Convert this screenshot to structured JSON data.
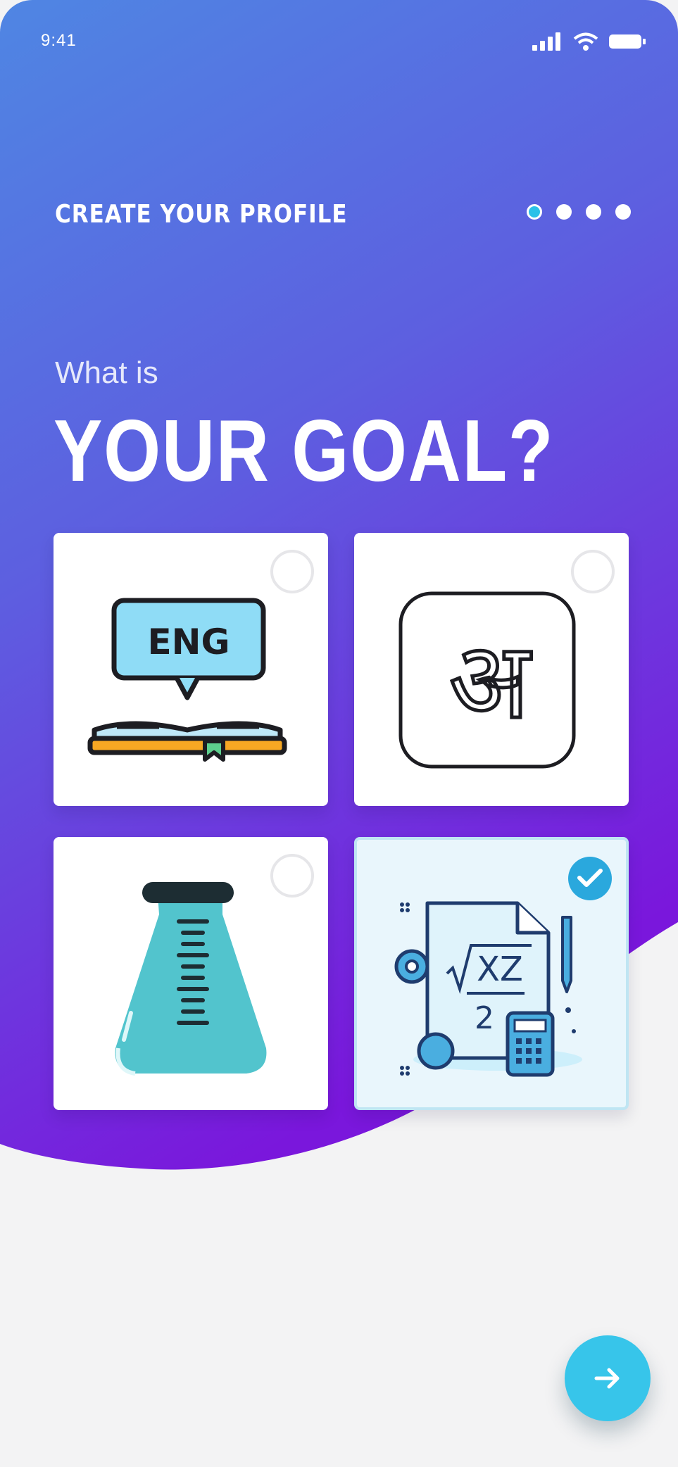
{
  "status_bar": {
    "time": "9:41"
  },
  "header": {
    "kicker": "CREATE YOUR PROFILE",
    "steps": 4,
    "current_step": 1
  },
  "question": {
    "lead": "What is",
    "title": "YOUR GOAL?"
  },
  "goals": [
    {
      "id": "english",
      "icon": "eng-book-icon",
      "badge_text": "ENG",
      "selected": false
    },
    {
      "id": "hindi",
      "icon": "hindi-letter-icon",
      "badge_text": "अ",
      "selected": false
    },
    {
      "id": "science",
      "icon": "flask-icon",
      "selected": false
    },
    {
      "id": "maths",
      "icon": "math-worksheet-icon",
      "badge_text": "√XZ/2",
      "selected": true
    }
  ],
  "colors": {
    "gradient_top": "#4f86e3",
    "gradient_bottom": "#7a1cdd",
    "accent": "#37c5ea",
    "check": "#2aa8dd"
  },
  "actions": {
    "next_icon": "arrow-right-icon"
  }
}
